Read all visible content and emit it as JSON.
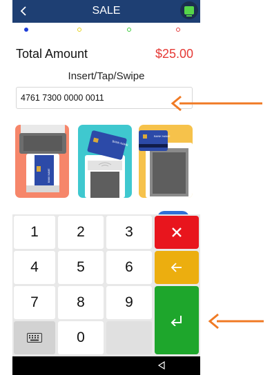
{
  "header": {
    "title": "SALE",
    "back_icon": "chevron-left-icon",
    "status_icon": "terminal-status-icon"
  },
  "steps": {
    "colors": [
      "#1d3dd8",
      "#e6d21d",
      "#3bcc3b",
      "#e33b3b"
    ]
  },
  "transaction": {
    "total_label": "Total Amount",
    "total_value": "$25.00",
    "instruction": "Insert/Tap/Swipe",
    "card_number": "4761 7300 0000 0011"
  },
  "illustrations": [
    {
      "name": "insert-card-illustration",
      "card_text": "BANK NAME"
    },
    {
      "name": "tap-card-illustration",
      "card_text": "BANK NAME"
    },
    {
      "name": "swipe-card-illustration",
      "card_text": "BANK NAME"
    }
  ],
  "keypad": {
    "keys": [
      "1",
      "2",
      "3",
      "4",
      "5",
      "6",
      "7",
      "8",
      "9",
      "0"
    ],
    "keyboard_icon": "keyboard-icon",
    "delete_icon": "close-icon",
    "backspace_icon": "arrow-left-icon",
    "enter_icon": "enter-icon",
    "colors": {
      "delete": "#e8151d",
      "backspace": "#ecae0f",
      "enter": "#1ea62c"
    }
  },
  "navbar": {
    "back_icon": "nav-back-triangle-icon"
  },
  "annotations": {
    "color": "#f07a24"
  }
}
